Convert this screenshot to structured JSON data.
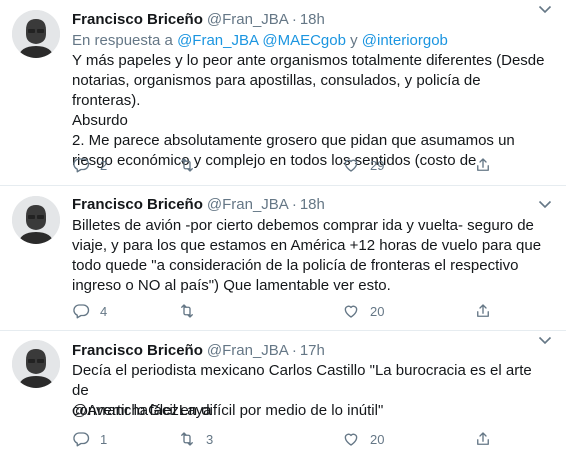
{
  "tweets": [
    {
      "name": "Francisco Briceño",
      "handle": "@Fran_JBA",
      "separator": "·",
      "time": "18h",
      "reply_prefix": "En respuesta a",
      "reply_mentions": [
        "@Fran_JBA",
        "@MAECgob",
        "@interiorgob"
      ],
      "reply_join": "y",
      "text": "Y más papeles y lo peor ante organismos totalmente diferentes (Desde\nnotarias, organismos para apostillas, consulados, y policía de fronteras).\nAbsurdo\n2. Me parece absolutamente grosero que pidan que asumamos un\nriesgo económico y complejo en todos los sentidos (costo de",
      "replies": "2",
      "retweets": "",
      "likes": "29"
    },
    {
      "name": "Francisco Briceño",
      "handle": "@Fran_JBA",
      "separator": "·",
      "time": "18h",
      "text": "Billetes de avión -por cierto debemos comprar ida y vuelta- seguro de\nviaje, y para los que estamos en América +12 horas de vuelo para que\ntodo quede \"a consideración de la policía de fronteras el respectivo\ningreso o NO al país\") Que lamentable ver esto.",
      "replies": "4",
      "retweets": "",
      "likes": "20"
    },
    {
      "name": "Francisco Briceño",
      "handle": "@Fran_JBA",
      "separator": "·",
      "time": "17h",
      "text": "Decía el periodista mexicano Carlos Castillo \"La burocracia es el arte de\nconvertir lo fácil en difícil por medio de lo inútil\"",
      "mention_line": "@ArranchaGlezLaya",
      "replies": "1",
      "retweets": "3",
      "likes": "20"
    }
  ],
  "icons": {
    "reply": "reply-icon",
    "retweet": "retweet-icon",
    "like": "heart-icon",
    "share": "share-icon",
    "more": "chevron-down-icon"
  },
  "colors": {
    "link": "#1b95e0",
    "secondary": "#657786",
    "text": "#14171a",
    "divider": "#e6ecf0"
  }
}
